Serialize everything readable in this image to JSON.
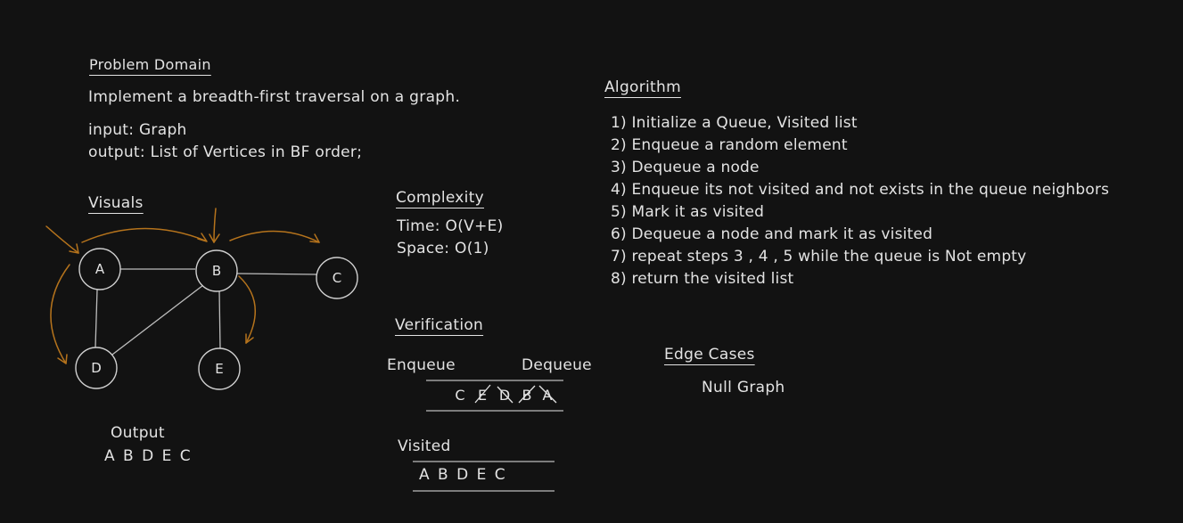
{
  "problem": {
    "heading": "Problem Domain",
    "description": "Implement a breadth-first traversal on a graph.",
    "input": "input: Graph",
    "output": "output: List of Vertices in BF order;"
  },
  "visuals": {
    "heading": "Visuals",
    "nodes": [
      "A",
      "B",
      "C",
      "D",
      "E"
    ],
    "output_label": "Output",
    "output_value": "A B D E C"
  },
  "complexity": {
    "heading": "Complexity",
    "time": "Time: O(V+E)",
    "space": "Space: O(1)"
  },
  "verification": {
    "heading": "Verification",
    "enqueue_label": "Enqueue",
    "dequeue_label": "Dequeue",
    "queue_items": [
      "C",
      "E",
      "D",
      "B",
      "A"
    ],
    "visited_label": "Visited",
    "visited_value": "A B D E C"
  },
  "algorithm": {
    "heading": "Algorithm",
    "steps": [
      "1) Initialize a Queue, Visited list",
      "2) Enqueue a random element",
      "3) Dequeue a node",
      "4) Enqueue its not visited and not exists in the queue neighbors",
      "5) Mark it as visited",
      "6) Dequeue a node and mark it as visited",
      "7) repeat steps 3 , 4 , 5 while the queue is Not empty",
      "8) return the visited list"
    ]
  },
  "edge_cases": {
    "heading": "Edge Cases",
    "items": [
      "Null Graph"
    ]
  },
  "colors": {
    "background": "#121212",
    "text": "#e3e3e3",
    "arrow": "#b5731c"
  }
}
